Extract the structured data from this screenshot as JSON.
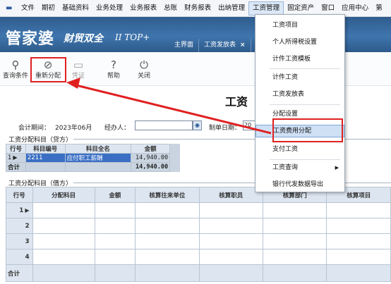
{
  "menubar": {
    "items": [
      "文件",
      "期初",
      "基础资料",
      "业务处理",
      "业务报表",
      "总账",
      "财务报表",
      "出纳管理",
      "工资管理",
      "固定资产",
      "窗口",
      "应用中心",
      "第"
    ]
  },
  "banner": {
    "logo_main": "管家婆",
    "logo_sub": "财贸双全",
    "logo_edition": "II TOP+",
    "tabs": [
      {
        "label": "主界面"
      },
      {
        "label": "工资发放表",
        "close": "×"
      }
    ]
  },
  "toolbar": {
    "query_label": "查询条件",
    "reallocate_label": "重新分配",
    "voucher_label": "凭证",
    "help_label": "帮助",
    "close_label": "关闭"
  },
  "page": {
    "title": "工资"
  },
  "header": {
    "period_label": "会计期间：",
    "period_value": "2023年06月",
    "handler_label": "经办人：",
    "date_label": "制单日期：",
    "date_value": "20"
  },
  "credit": {
    "section_label": "工资分配科目（贷方）",
    "headers": [
      "行号",
      "科目编号",
      "科目全名",
      "金额"
    ],
    "rows": [
      {
        "no": "1",
        "code": "2211",
        "name": "应付职工薪酬",
        "amount": "14,940.00"
      }
    ],
    "total_label": "合计",
    "total_amount": "14,940.00"
  },
  "debit": {
    "section_label": "工资分配科目（借方）",
    "headers": [
      "行号",
      "分配科目",
      "金额",
      "核算往来单位",
      "核算职员",
      "核算部门",
      "核算项目"
    ],
    "rows": [
      "1",
      "2",
      "3",
      "4"
    ],
    "total_label": "合计"
  },
  "dropdown": {
    "items": [
      {
        "label": "工资项目"
      },
      {
        "label": "个人所得税设置"
      },
      {
        "label": "计件工资模板"
      },
      {
        "label": "计件工资"
      },
      {
        "label": "工资发放表"
      },
      {
        "label": "分配设置"
      },
      {
        "label": "工资费用分配"
      },
      {
        "label": "支付工资"
      },
      {
        "label": "工资查询",
        "arrow": "▶"
      },
      {
        "label": "银行代发数据导出"
      }
    ]
  },
  "colors": {
    "banner": "#3f75ad",
    "highlight_red": "#e02020",
    "selection_blue": "#3a6fc4"
  }
}
